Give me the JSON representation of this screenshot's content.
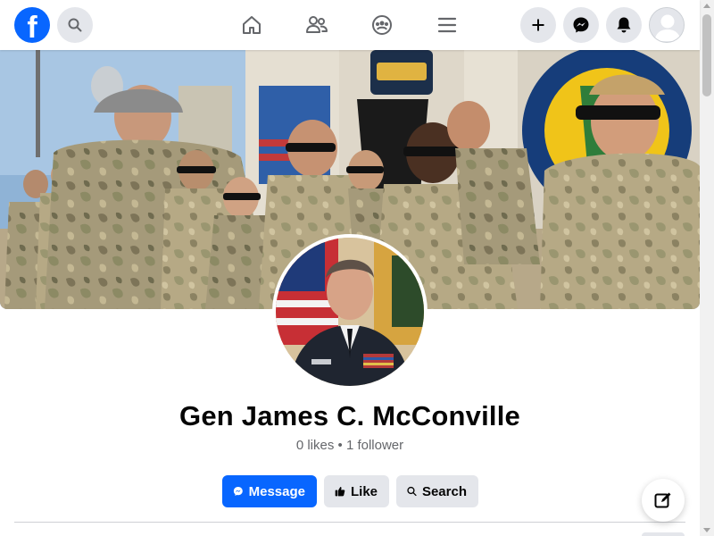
{
  "header": {
    "logo_letter": "f",
    "icons": {
      "logo": "facebook-logo",
      "search": "search-icon",
      "home": "home-icon",
      "friends": "friends-icon",
      "groups": "groups-icon",
      "menu": "menu-icon",
      "create": "plus-icon",
      "messenger": "messenger-icon",
      "notifications": "bell-icon",
      "account": "avatar"
    }
  },
  "profile": {
    "name": "Gen James C. McConville",
    "stats": "0 likes • 1 follower"
  },
  "actions": {
    "message_label": "Message",
    "like_label": "Like",
    "search_label": "Search"
  },
  "colors": {
    "brand": "#0866ff",
    "secondary_button": "#e4e6eb",
    "text_primary": "#050505",
    "text_secondary": "#65676b"
  }
}
